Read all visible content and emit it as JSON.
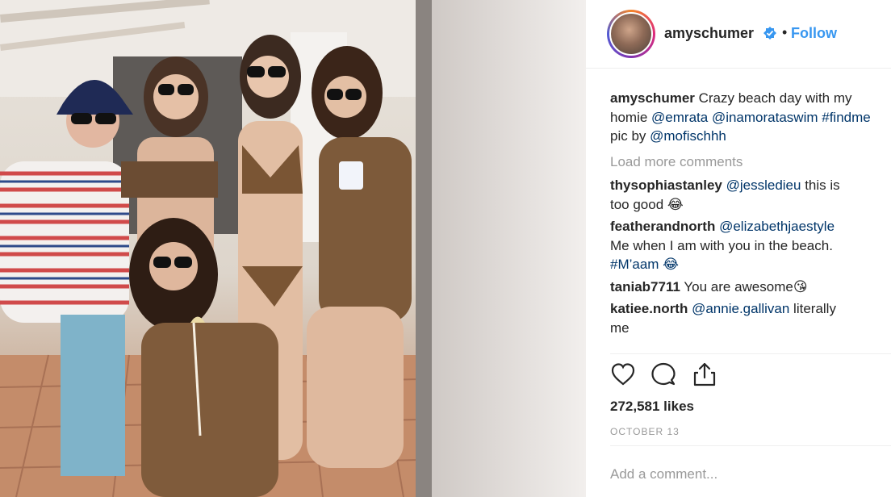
{
  "post": {
    "username": "amyschumer",
    "follow_label": "Follow",
    "separator": "•",
    "caption_user": "amyschumer",
    "caption_line1": " Crazy beach day with my",
    "caption_line2_prefix": "homie ",
    "caption_mention1": "@emrata",
    "caption_mention2": "@inamorataswim",
    "caption_mention3": "#findme",
    "caption_line3_prefix": "pic by ",
    "caption_mention4": "@mofischhh",
    "load_more": "Load more comments",
    "comments": [
      {
        "user": "thysophiastanley",
        "mention": "@jessledieu",
        "text": " this is",
        "text2": "too good 😂"
      },
      {
        "user": "featherandnorth",
        "mention": "@elizabethjaestyle",
        "text": "",
        "text2": "Me when I am with you in the beach.",
        "text3": "#M’aam 😂"
      },
      {
        "user": "taniab7711",
        "mention": "",
        "text": " You are awesome😘",
        "text2": ""
      },
      {
        "user": "katiee.north",
        "mention": "@annie.gallivan",
        "text": " literally",
        "text2": "me"
      }
    ],
    "likes": "272,581 likes",
    "date": "OCTOBER 13",
    "add_comment_placeholder": "Add a comment..."
  },
  "icons": {
    "like": "heart-icon",
    "comment": "comment-icon",
    "share": "share-icon",
    "verified": "verified-badge-icon"
  },
  "colors": {
    "link": "#3897f0",
    "mention": "#003569",
    "muted": "#999999",
    "text": "#262626"
  }
}
